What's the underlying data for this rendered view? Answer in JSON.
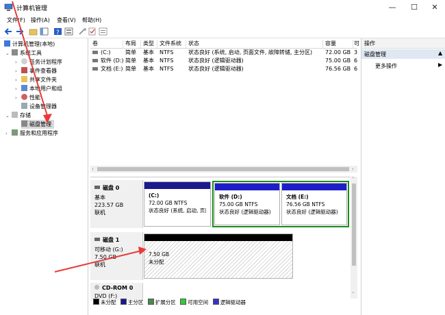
{
  "window": {
    "title": "计算机管理"
  },
  "menu": [
    "文件(F)",
    "操作(A)",
    "查看(V)",
    "帮助(H)"
  ],
  "tree": {
    "root": "计算机管理(本地)",
    "system_tools": "系统工具",
    "items": [
      "任务计划程序",
      "事件查看器",
      "共享文件夹",
      "本地用户和组",
      "性能",
      "设备管理器"
    ],
    "storage": "存储",
    "disk_mgmt": "磁盘管理",
    "services": "服务和应用程序"
  },
  "list": {
    "headers": [
      "卷",
      "布局",
      "类型",
      "文件系统",
      "状态",
      "容量",
      "可"
    ],
    "rows": [
      {
        "vol": "(C:)",
        "layout": "简单",
        "type": "基本",
        "fs": "NTFS",
        "status": "状态良好 (系统, 启动, 页面文件, 故障转储, 主分区)",
        "cap": "72.00 GB",
        "free": "3"
      },
      {
        "vol": "软件 (D:)",
        "layout": "简单",
        "type": "基本",
        "fs": "NTFS",
        "status": "状态良好 (逻辑驱动器)",
        "cap": "75.00 GB",
        "free": "6"
      },
      {
        "vol": "文档 (E:)",
        "layout": "简单",
        "type": "基本",
        "fs": "NTFS",
        "status": "状态良好 (逻辑驱动器)",
        "cap": "76.56 GB",
        "free": "6"
      }
    ]
  },
  "disks": [
    {
      "name": "磁盘 0",
      "kind": "基本",
      "size": "223.57 GB",
      "state": "联机",
      "parts": [
        {
          "title": "(C:)",
          "size": "72.00 GB NTFS",
          "status": "状态良好 (系统, 启动, 页面"
        },
        {
          "title": "软件 (D:)",
          "size": "75.00 GB NTFS",
          "status": "状态良好 (逻辑驱动器)"
        },
        {
          "title": "文档 (E:)",
          "size": "76.56 GB NTFS",
          "status": "状态良好 (逻辑驱动器)"
        }
      ]
    },
    {
      "name": "磁盘 1",
      "kind": "可移动 (G:)",
      "size": "7.50 GB",
      "state": "联机",
      "parts": [
        {
          "size": "7.50 GB",
          "status": "未分配"
        }
      ]
    },
    {
      "name": "CD-ROM 0",
      "kind": "DVD (F:)"
    }
  ],
  "legend": [
    "未分配",
    "主分区",
    "扩展分区",
    "可用空间",
    "逻辑驱动器"
  ],
  "legend_colors": [
    "#000000",
    "#1a1a8c",
    "#4a8a4a",
    "#33cc33",
    "#3333cc"
  ],
  "actions": {
    "header": "操作",
    "section": "磁盘管理",
    "more": "更多操作"
  },
  "colors": {
    "partition_bar": "#1e1ec8",
    "selected_border": "#1a8c1a",
    "unalloc_bar": "#000000",
    "annotation": "#e83a3a"
  }
}
